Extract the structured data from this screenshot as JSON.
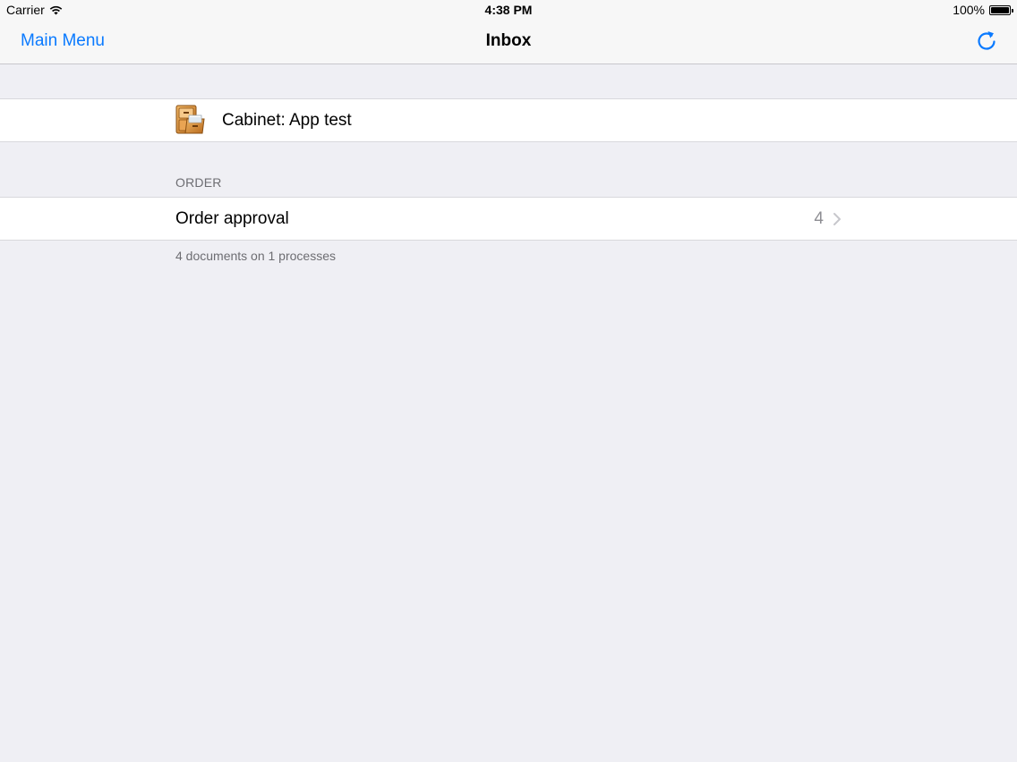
{
  "status_bar": {
    "carrier": "Carrier",
    "time": "4:38 PM",
    "battery": "100%",
    "battery_level": 1.0,
    "wifi_icon": "wifi-icon"
  },
  "nav": {
    "back_label": "Main Menu",
    "title": "Inbox",
    "refresh_icon": "refresh-icon",
    "accent_color": "#0a7aff"
  },
  "cabinet": {
    "label": "Cabinet: App test",
    "icon": "cabinet-icon"
  },
  "sections": [
    {
      "header": "ORDER",
      "rows": [
        {
          "label": "Order approval",
          "count": "4",
          "icon": "chevron-right-icon"
        }
      ],
      "footer": "4 documents on 1 processes"
    }
  ]
}
